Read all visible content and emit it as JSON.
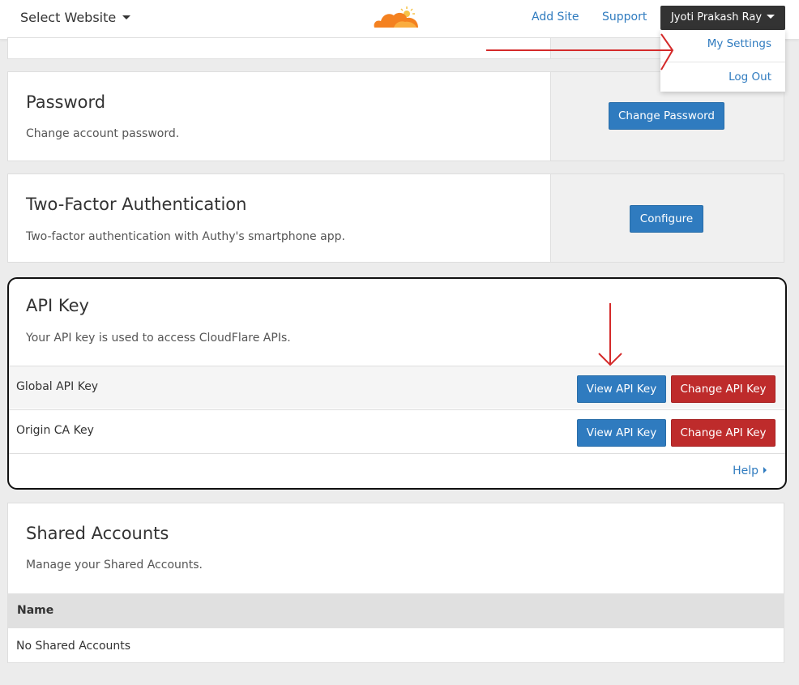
{
  "header": {
    "select_website": "Select Website",
    "add_site": "Add Site",
    "support": "Support",
    "user_name": "Jyoti Prakash Ray"
  },
  "user_menu": {
    "items": [
      "My Settings",
      "Log Out"
    ]
  },
  "password": {
    "title": "Password",
    "description": "Change account password.",
    "button": "Change Password"
  },
  "two_factor": {
    "title": "Two-Factor Authentication",
    "description": "Two-factor authentication with Authy's smartphone app.",
    "button": "Configure"
  },
  "api_key": {
    "title": "API Key",
    "description": "Your API key is used to access CloudFlare APIs.",
    "rows": [
      {
        "label": "Global API Key",
        "view_button": "View API Key",
        "change_button": "Change API Key"
      },
      {
        "label": "Origin CA Key",
        "view_button": "View API Key",
        "change_button": "Change API Key"
      }
    ],
    "help": "Help"
  },
  "shared_accounts": {
    "title": "Shared Accounts",
    "description": "Manage your Shared Accounts.",
    "column_name": "Name",
    "empty_text": "No Shared Accounts"
  },
  "colors": {
    "link_blue": "#2f7bbf",
    "danger_red": "#be2b2b",
    "annotation_red": "#d42a2a",
    "logo_orange": "#f48120"
  }
}
